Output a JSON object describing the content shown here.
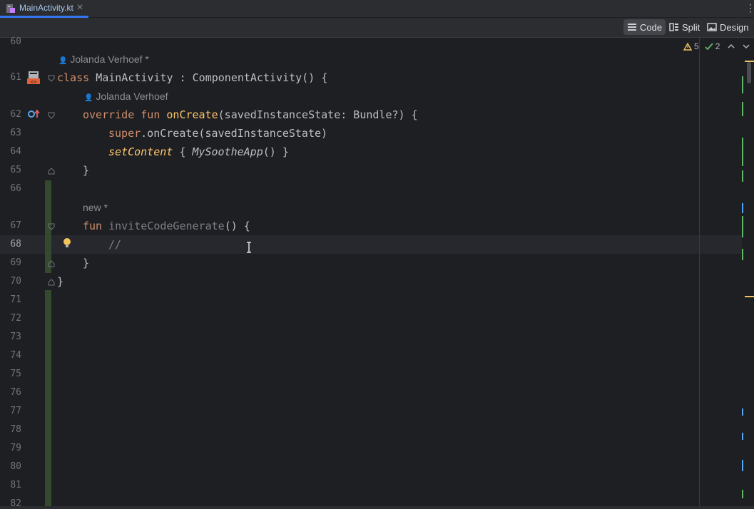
{
  "tabs": [
    {
      "label": "MainActivity.kt",
      "close": "✕",
      "icon": "kotlin-file-icon"
    }
  ],
  "menu_icon": "⋮",
  "view_modes": [
    {
      "label": "Code",
      "icon": "code-lines-icon",
      "active": true
    },
    {
      "label": "Split",
      "icon": "split-icon",
      "active": false
    },
    {
      "label": "Design",
      "icon": "image-icon",
      "active": false
    }
  ],
  "inspections": {
    "warnings": "5",
    "weak_warnings": "2"
  },
  "hints": {
    "author1": "Jolanda Verhoef *",
    "author2": "Jolanda Verhoef",
    "new": "new *"
  },
  "line_numbers": [
    "60",
    "61",
    "62",
    "63",
    "64",
    "65",
    "66",
    "67",
    "68",
    "69",
    "70",
    "71",
    "72",
    "73",
    "74",
    "75",
    "76",
    "77",
    "78",
    "79",
    "80",
    "81",
    "82"
  ],
  "current_line": "68",
  "code": {
    "l61": {
      "kw": "class ",
      "name": "MainActivity",
      "rest": " : ComponentActivity() {"
    },
    "l62": {
      "kw": "override fun ",
      "fn": "onCreate",
      "rest": "(savedInstanceState: Bundle?) {"
    },
    "l63": {
      "kw": "super",
      "rest": ".onCreate(savedInstanceState)"
    },
    "l64": {
      "fn": "setContent",
      "mid": " { ",
      "call": "MySootheApp",
      "rest": "() }"
    },
    "l65": "}",
    "l67": {
      "kw": "fun ",
      "fn": "inviteCodeGenerate",
      "rest": "() {"
    },
    "l68": "//",
    "l69": "}",
    "l70": "}"
  },
  "colors": {
    "accent": "#3574f0",
    "keyword": "#cf8e6d",
    "function": "#56a8f5",
    "warning": "#f2c55c",
    "ok": "#5fb865"
  }
}
